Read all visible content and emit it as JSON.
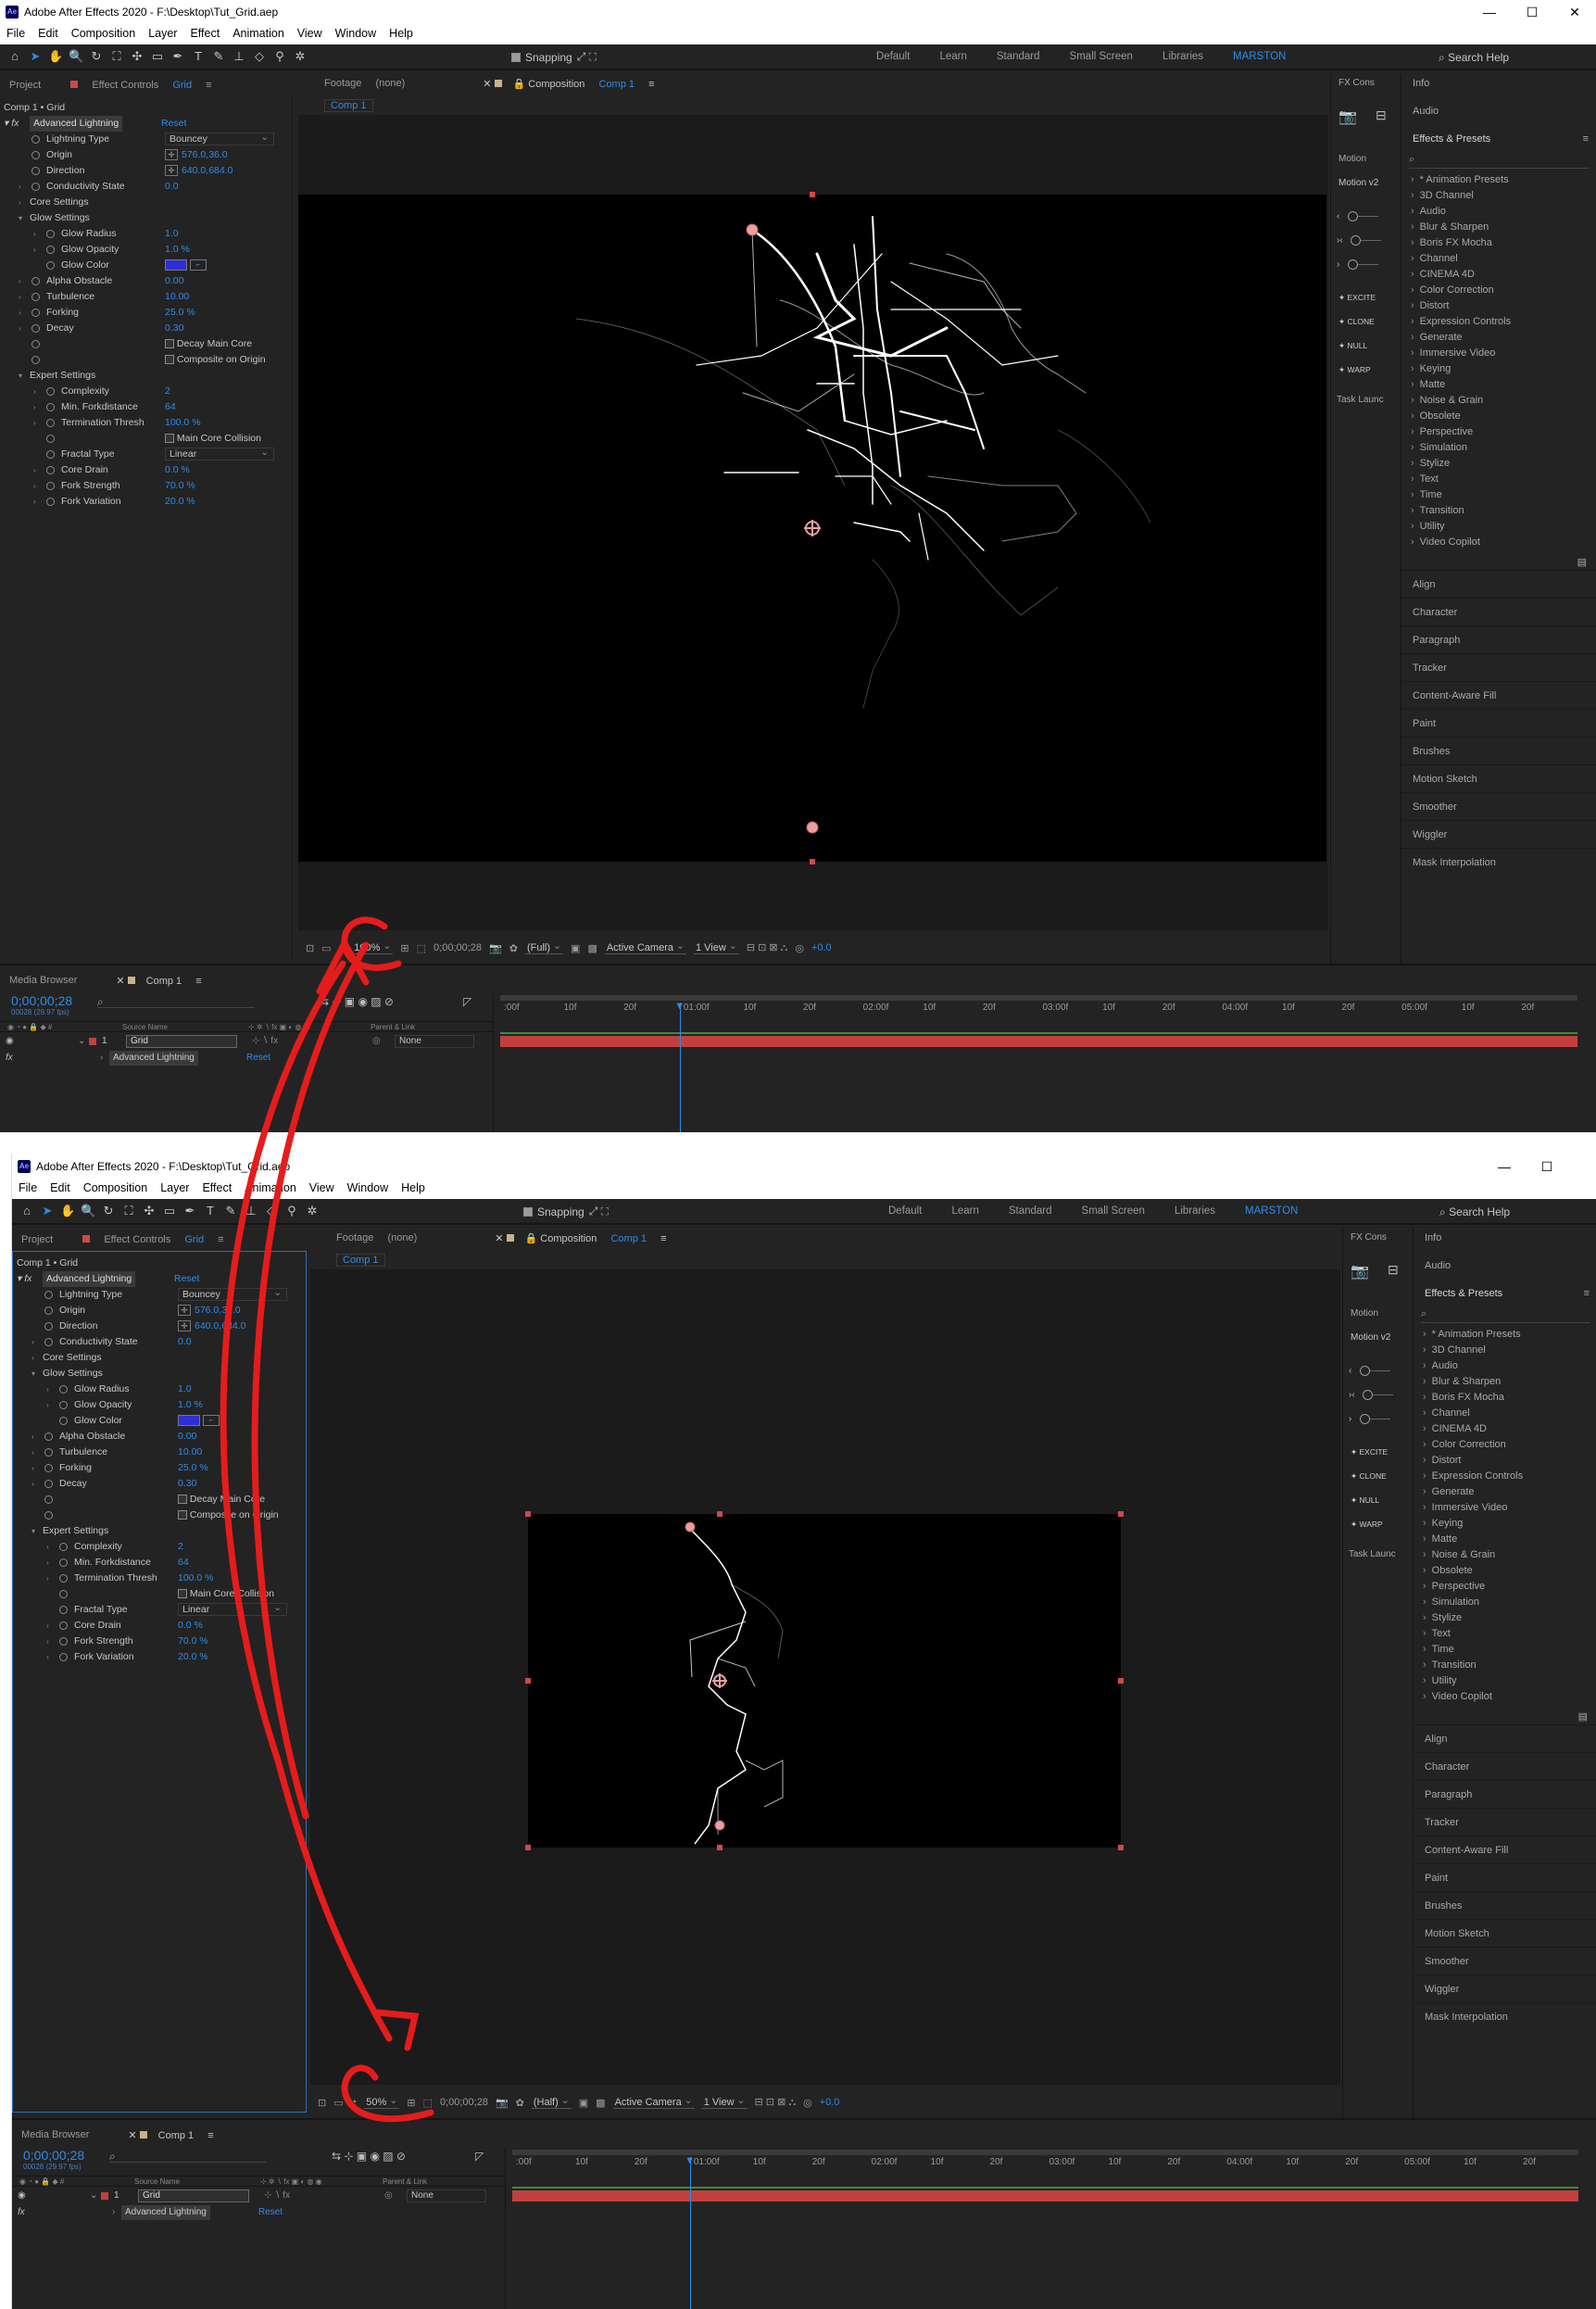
{
  "app": {
    "title": "Adobe After Effects 2020 - F:\\Desktop\\Tut_Grid.aep",
    "menu": [
      "File",
      "Edit",
      "Composition",
      "Layer",
      "Effect",
      "Animation",
      "View",
      "Window",
      "Help"
    ],
    "snapping": "Snapping",
    "workspaces": [
      "Default",
      "Learn",
      "Standard",
      "Small Screen",
      "Libraries",
      "MARSTON"
    ],
    "search_help": "Search Help"
  },
  "panel_tabs": {
    "project": "Project",
    "effect_controls": "Effect Controls",
    "effect_controls_layer": "Grid",
    "footage": "Footage",
    "footage_state": "(none)",
    "composition": "Composition",
    "composition_name": "Comp 1",
    "comp_tab": "Comp 1"
  },
  "effect_controls": {
    "header": "Comp 1 • Grid",
    "effect_name": "Advanced Lightning",
    "reset": "Reset",
    "rows": [
      {
        "name": "Lightning Type",
        "indent": 1,
        "type": "dropdown",
        "value": "Bouncey"
      },
      {
        "name": "Origin",
        "indent": 1,
        "type": "point",
        "value": "576.0,36.0"
      },
      {
        "name": "Direction",
        "indent": 1,
        "type": "point",
        "value": "640.0,684.0"
      },
      {
        "name": "Conductivity State",
        "indent": 1,
        "type": "num",
        "value": "0.0",
        "twirl": true
      },
      {
        "name": "Core Settings",
        "indent": 1,
        "type": "group",
        "value": "",
        "twirl": true
      },
      {
        "name": "Glow Settings",
        "indent": 1,
        "type": "group",
        "value": "",
        "twirl": true,
        "open": true
      },
      {
        "name": "Glow Radius",
        "indent": 2,
        "type": "num",
        "value": "1.0",
        "twirl": true
      },
      {
        "name": "Glow Opacity",
        "indent": 2,
        "type": "num",
        "value": "1.0 %",
        "twirl": true
      },
      {
        "name": "Glow Color",
        "indent": 2,
        "type": "color",
        "value": ""
      },
      {
        "name": "Alpha Obstacle",
        "indent": 1,
        "type": "num",
        "value": "0.00",
        "twirl": true
      },
      {
        "name": "Turbulence",
        "indent": 1,
        "type": "num",
        "value": "10.00",
        "twirl": true
      },
      {
        "name": "Forking",
        "indent": 1,
        "type": "num",
        "value": "25.0 %",
        "twirl": true
      },
      {
        "name": "Decay",
        "indent": 1,
        "type": "num",
        "value": "0.30",
        "twirl": true
      },
      {
        "name": "",
        "indent": 1,
        "type": "check",
        "value": "Decay Main Core"
      },
      {
        "name": "",
        "indent": 1,
        "type": "check",
        "value": "Composite on Origin"
      },
      {
        "name": "Expert Settings",
        "indent": 1,
        "type": "group",
        "value": "",
        "twirl": true,
        "open": true
      },
      {
        "name": "Complexity",
        "indent": 2,
        "type": "num",
        "value": "2",
        "twirl": true
      },
      {
        "name": "Min. Forkdistance",
        "indent": 2,
        "type": "num",
        "value": "64",
        "twirl": true
      },
      {
        "name": "Termination Thresh",
        "indent": 2,
        "type": "num",
        "value": "100.0 %",
        "twirl": true
      },
      {
        "name": "",
        "indent": 2,
        "type": "check",
        "value": "Main Core Collision"
      },
      {
        "name": "Fractal Type",
        "indent": 2,
        "type": "dropdown",
        "value": "Linear"
      },
      {
        "name": "Core Drain",
        "indent": 2,
        "type": "num",
        "value": "0.0 %",
        "twirl": true
      },
      {
        "name": "Fork Strength",
        "indent": 2,
        "type": "num",
        "value": "70.0 %",
        "twirl": true
      },
      {
        "name": "Fork Variation",
        "indent": 2,
        "type": "num",
        "value": "20.0 %",
        "twirl": true
      }
    ]
  },
  "viewer_top": {
    "zoom": "100%",
    "timecode": "0;00;00;28",
    "resolution": "(Full)",
    "camera": "Active Camera",
    "views": "1 View",
    "exposure": "+0.0"
  },
  "viewer_bottom": {
    "zoom": "50%",
    "timecode": "0;00;00;28",
    "resolution": "(Half)",
    "camera": "Active Camera",
    "views": "1 View",
    "exposure": "+0.0"
  },
  "right_panel": {
    "fx_console": "FX Cons",
    "info": "Info",
    "audio": "Audio",
    "effects_presets": "Effects & Presets",
    "motion": "Motion",
    "motion_v2": "Motion v2",
    "task_launcher": "Task Launc",
    "motion_buttons": [
      "EXCITE",
      "CLONE",
      "NULL",
      "WARP"
    ],
    "categories": [
      "* Animation Presets",
      "3D Channel",
      "Audio",
      "Blur & Sharpen",
      "Boris FX Mocha",
      "Channel",
      "CINEMA 4D",
      "Color Correction",
      "Distort",
      "Expression Controls",
      "Generate",
      "Immersive Video",
      "Keying",
      "Matte",
      "Noise & Grain",
      "Obsolete",
      "Perspective",
      "Simulation",
      "Stylize",
      "Text",
      "Time",
      "Transition",
      "Utility",
      "Video Copilot"
    ],
    "panels": [
      "Align",
      "Character",
      "Paragraph",
      "Tracker",
      "Content-Aware Fill",
      "Paint",
      "Brushes",
      "Motion Sketch",
      "Smoother",
      "Wiggler",
      "Mask Interpolation"
    ]
  },
  "timeline": {
    "media_browser": "Media Browser",
    "comp_tab": "Comp 1",
    "timecode": "0;00;00;28",
    "fps": "00028 (29.97 fps)",
    "col_source": "Source Name",
    "col_parent": "Parent & Link",
    "layer_index": "1",
    "layer_name": "Grid",
    "parent_value": "None",
    "effect_row": "Advanced Lightning",
    "reset": "Reset",
    "ruler": [
      ":00f",
      "10f",
      "20f",
      "01:00f",
      "10f",
      "20f",
      "02:00f",
      "10f",
      "20f",
      "03:00f",
      "10f",
      "20f",
      "04:00f",
      "10f",
      "20f",
      "05:00f",
      "10f",
      "20f"
    ]
  },
  "colors": {
    "ui_bg": "#232323",
    "accent_blue": "#2d8ceb",
    "layer_red": "#c1403f",
    "glow_color": "#2e2ed8",
    "annotation_red": "#e51c1c"
  }
}
